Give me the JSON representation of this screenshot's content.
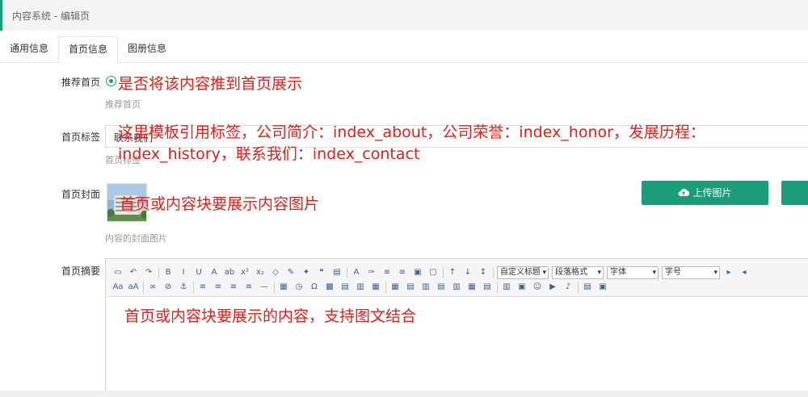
{
  "header": {
    "breadcrumb": "内容系统 - 编辑页"
  },
  "tabs": [
    {
      "label": "通用信息",
      "active": false
    },
    {
      "label": "首页信息",
      "active": true
    },
    {
      "label": "图册信息",
      "active": false
    }
  ],
  "form": {
    "recommend": {
      "label": "推荐首页",
      "hint": "推荐首页",
      "selected": true
    },
    "tag": {
      "label": "首页标签",
      "value": "联系我们",
      "hint": "首页标签"
    },
    "cover": {
      "label": "首页封面",
      "hint": "内容的封面图片",
      "upload_label": "上传图片"
    },
    "summary": {
      "label": "首页摘要"
    }
  },
  "editor": {
    "selects": {
      "custom_heading": "自定义标题",
      "paragraph": "段落格式",
      "font": "字体",
      "size": "字号"
    },
    "icons_row1": [
      "html-icon",
      "undo-icon",
      "redo-icon",
      "bold-icon",
      "italic-icon",
      "underline-icon",
      "font-border-icon",
      "strikethrough-icon",
      "superscript-icon",
      "subscript-icon",
      "eraser-icon",
      "format-brush-icon",
      "auto-format-icon",
      "quote-icon",
      "paste-plain-icon",
      "font-color-icon",
      "highlight-icon",
      "ordered-list-icon",
      "unordered-list-icon",
      "select-all-icon",
      "clear-doc-icon",
      "row-spacing-top-icon",
      "row-spacing-bottom-icon",
      "line-height-icon",
      "ltr-icon",
      "rtl-icon"
    ],
    "icons_row2": [
      "uppercase-icon",
      "lowercase-icon",
      "link-icon",
      "unlink-icon",
      "anchor-icon",
      "align-left-icon",
      "align-center-icon",
      "align-right-icon",
      "align-justify-icon",
      "hr-icon",
      "date-icon",
      "time-icon",
      "special-char-icon",
      "map-icon",
      "insert-frame-icon",
      "page-break-icon",
      "template-icon",
      "table-icon",
      "insert-row-icon",
      "insert-col-icon",
      "delete-row-icon",
      "delete-col-icon",
      "merge-cells-icon",
      "split-cells-icon",
      "image-icon",
      "emotion-icon",
      "video-icon",
      "music-icon",
      "attachment-icon",
      "preview-icon",
      "search-replace-icon"
    ]
  },
  "annotations": {
    "a1": "是否将该内容推到首页展示",
    "a2_line1": "这里模板引用标签，公司简介：index_about，公司荣誉：index_honor，发展历程：",
    "a2_line2": "index_history，联系我们：index_contact",
    "a3": "首页或内容块要展示内容图片",
    "a4": "首页或内容块要展示的内容，支持图文结合"
  },
  "colors": {
    "accent": "#1a9d78",
    "annotation": "#e0201b"
  }
}
